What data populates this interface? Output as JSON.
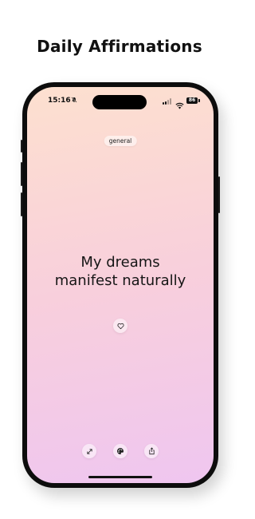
{
  "headline": "Daily Affirmations",
  "status_bar": {
    "time": "15:16",
    "battery": "86"
  },
  "category": "general",
  "affirmation": {
    "line1": "My dreams",
    "line2": "manifest naturally"
  },
  "icons": {
    "favorite": "heart-icon",
    "fullscreen": "expand-icon",
    "theme": "palette-icon",
    "share": "share-icon",
    "mute": "bell-slash-icon"
  },
  "colors": {
    "gradient_top": "#fde0cf",
    "gradient_mid": "#f8cfdc",
    "gradient_bottom": "#efc6f0",
    "text": "#161616"
  }
}
